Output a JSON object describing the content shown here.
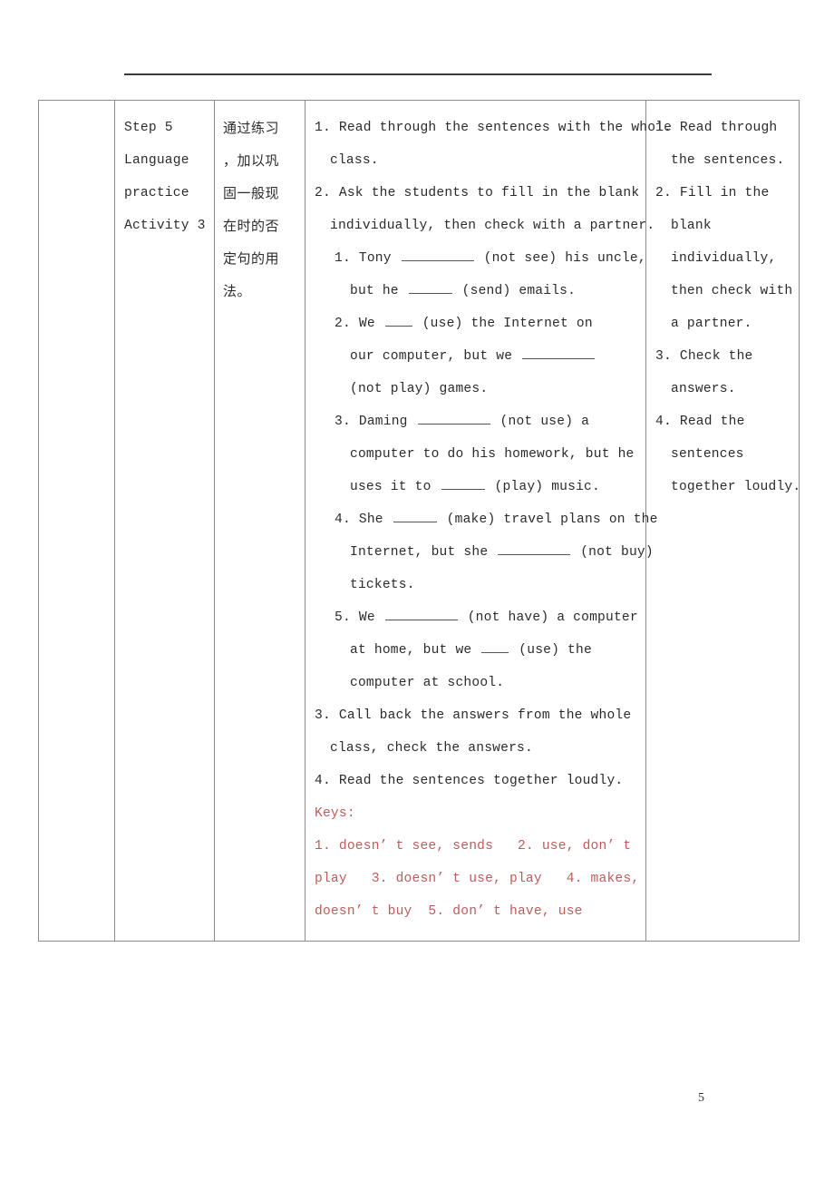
{
  "document": {
    "page_number": "5",
    "keys_color": "#bf5b5b"
  },
  "table": {
    "col_step": {
      "lines": [
        "Step 5",
        "Language",
        "practice",
        "Activity 3"
      ]
    },
    "col_purpose": {
      "lines": [
        "通过练习",
        "，加以巩",
        "固一般现",
        "在时的否",
        "定句的用",
        "法。"
      ]
    },
    "col_procedure": {
      "lines": [
        {
          "indent": 0,
          "text": "1. Read through the sentences with the whole"
        },
        {
          "indent": 1,
          "text": "class."
        },
        {
          "indent": 0,
          "text": "2. Ask the students to fill in the blank"
        },
        {
          "indent": 1,
          "text": "individually, then check with a partner."
        },
        {
          "indent": 2,
          "segments": [
            "1. Tony ",
            "__blank_l__",
            " (not see) his uncle,"
          ]
        },
        {
          "indent": 3,
          "segments": [
            "but he ",
            "__blank_m__",
            " (send) emails."
          ]
        },
        {
          "indent": 2,
          "segments": [
            "2. We ",
            "__blank_s__",
            " (use) the Internet on"
          ]
        },
        {
          "indent": 3,
          "segments": [
            "our computer, but we ",
            "__blank_l__",
            ""
          ]
        },
        {
          "indent": 3,
          "text": "(not play) games."
        },
        {
          "indent": 2,
          "segments": [
            "3. Daming ",
            "__blank_l__",
            " (not use) a"
          ]
        },
        {
          "indent": 3,
          "text": "computer to do his homework, but he"
        },
        {
          "indent": 3,
          "segments": [
            "uses it to ",
            "__blank_m__",
            " (play) music."
          ]
        },
        {
          "indent": 2,
          "segments": [
            "4. She ",
            "__blank_m__",
            " (make) travel plans on the"
          ]
        },
        {
          "indent": 3,
          "segments": [
            "Internet, but she ",
            "__blank_l__",
            " (not buy)"
          ]
        },
        {
          "indent": 3,
          "text": "tickets."
        },
        {
          "indent": 2,
          "segments": [
            "5. We ",
            "__blank_l__",
            " (not have) a computer"
          ]
        },
        {
          "indent": 3,
          "segments": [
            "at home, but we ",
            "__blank_s__",
            " (use) the"
          ]
        },
        {
          "indent": 3,
          "text": "computer at school."
        },
        {
          "indent": 0,
          "text": "3. Call back the answers from the whole"
        },
        {
          "indent": 1,
          "text": "class, check the answers."
        },
        {
          "indent": 0,
          "text": "4. Read the sentences together loudly."
        },
        {
          "indent": 0,
          "text": "Keys:",
          "red": true
        },
        {
          "indent": 0,
          "text": "1. doesn’ t see, sends   2. use, don’ t",
          "red": true
        },
        {
          "indent": 0,
          "text": "play   3. doesn’ t use, play   4. makes,",
          "red": true
        },
        {
          "indent": 0,
          "text": "doesn’ t buy  5. don’ t have, use",
          "red": true
        }
      ]
    },
    "col_student": {
      "lines": [
        {
          "indent": 0,
          "text": "1. Read through"
        },
        {
          "indent": 1,
          "text": "the sentences."
        },
        {
          "indent": 0,
          "text": "2. Fill in the"
        },
        {
          "indent": 1,
          "text": "blank"
        },
        {
          "indent": 1,
          "text": "individually,"
        },
        {
          "indent": 1,
          "text": "then check with"
        },
        {
          "indent": 1,
          "text": "a partner."
        },
        {
          "indent": 0,
          "text": "3. Check the"
        },
        {
          "indent": 1,
          "text": "answers."
        },
        {
          "indent": 0,
          "text": "4. Read the"
        },
        {
          "indent": 1,
          "text": "sentences"
        },
        {
          "indent": 1,
          "text": "together loudly."
        }
      ]
    }
  }
}
